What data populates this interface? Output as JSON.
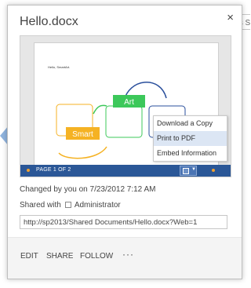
{
  "background": {
    "partial_text": "ts S"
  },
  "card": {
    "title": "Hello.docx",
    "close_symbol": "×",
    "preview": {
      "greeting": "Hello, SmartArt.",
      "smartart_labels": [
        "Art",
        "Smart"
      ],
      "page_indicator": "PAGE 1 OF 2",
      "colors": {
        "bar": "#2b5797",
        "art_box": "#3cc85a",
        "smart_box": "#f5b223",
        "arc_blue": "#2a4f9c",
        "dot": "#f0a030"
      }
    },
    "context_menu": {
      "items": [
        "Download a Copy",
        "Print to PDF",
        "Embed Information"
      ],
      "highlighted_index": 1
    },
    "changed_text": "Changed by you on 7/23/2012 7:12 AM",
    "shared_with_label": "Shared with",
    "shared_with_user": "Administrator",
    "url": "http://sp2013/Shared Documents/Hello.docx?Web=1",
    "actions": {
      "edit": "EDIT",
      "share": "SHARE",
      "follow": "FOLLOW",
      "more": "···"
    }
  }
}
